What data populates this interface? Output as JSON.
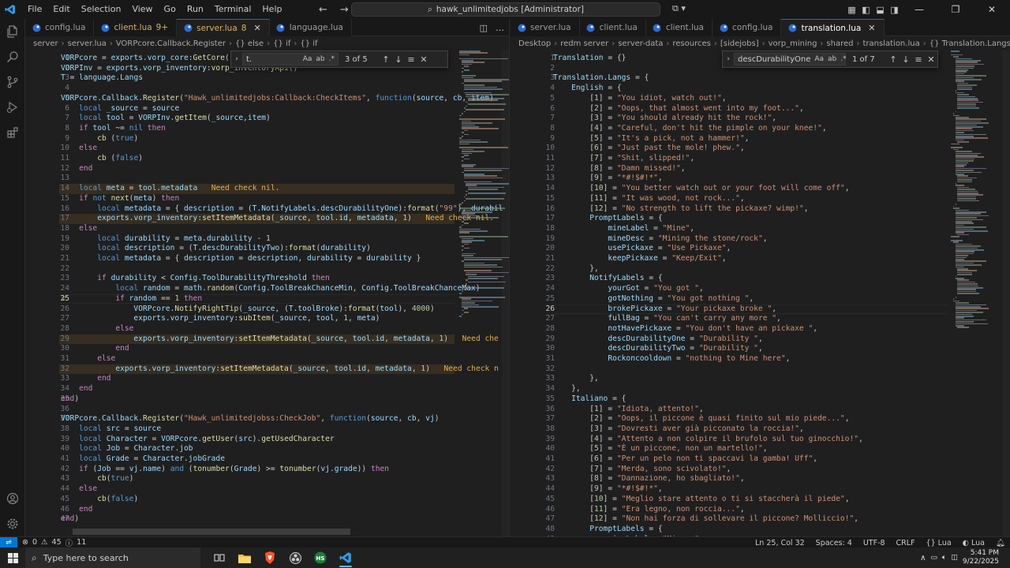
{
  "titlebar": {
    "menu": [
      "File",
      "Edit",
      "Selection",
      "View",
      "Go",
      "Run",
      "Terminal",
      "Help"
    ],
    "search_text": "hawk_unlimitedjobs [Administrator]"
  },
  "left": {
    "tabs": [
      {
        "label": "config.lua",
        "mod": "",
        "active": false
      },
      {
        "label": "client.lua",
        "mod": "9+",
        "active": false
      },
      {
        "label": "server.lua",
        "mod": "8",
        "active": true
      },
      {
        "label": "language.lua",
        "mod": "",
        "active": false
      }
    ],
    "breadcrumb": [
      "server",
      "server.lua",
      "VORPcore.Callback.Register",
      "{} else",
      "{} if",
      "{} if"
    ],
    "find": {
      "value": "t.",
      "count": "3 of 5"
    },
    "lines": [
      {
        "n": 1,
        "html": "<span class='var'>VORPcore</span> <span class='op'>=</span> <span class='var'>exports</span>.<span class='var'>vorp_core</span>:<span class='fn'>GetCore</span>()"
      },
      {
        "n": 2,
        "html": "<span class='var'>VORPInv</span> <span class='op'>=</span> <span class='var'>exports</span>.<span class='var'>vorp_inventory</span>:<span class='fn'>vorp_inventoryApi</span>()"
      },
      {
        "n": 3,
        "html": "<span class='var'>T</span> <span class='op'>=</span> <span class='var'>language</span>.<span class='var'>Langs</span>"
      },
      {
        "n": 4,
        "html": ""
      },
      {
        "n": 5,
        "html": "<span class='var'>VORPcore</span>.<span class='var'>Callback</span>.<span class='fn'>Register</span>(<span class='str'>\"Hawk_unlimitedjobs:Callback:CheckItems\"</span>, <span class='kb'>function</span>(<span class='var'>source</span>, <span class='var'>cb</span>, <span class='var'>item</span>)"
      },
      {
        "n": 6,
        "html": "    <span class='kb'>local</span> <span class='var'>_source</span> <span class='op'>=</span> <span class='var'>source</span>"
      },
      {
        "n": 7,
        "html": "    <span class='kb'>local</span> <span class='var'>tool</span> <span class='op'>=</span> <span class='var'>VORPInv</span>.<span class='fn'>getItem</span>(<span class='var'>_source</span>,<span class='var'>item</span>)"
      },
      {
        "n": 8,
        "html": "    <span class='kw'>if</span> <span class='var'>tool</span> <span class='op'>~=</span> <span class='kb'>nil</span> <span class='kw'>then</span>"
      },
      {
        "n": 9,
        "html": "        <span class='fn'>cb</span> (<span class='kb'>true</span>)"
      },
      {
        "n": 10,
        "html": "    <span class='kw'>else</span>"
      },
      {
        "n": 11,
        "html": "        <span class='fn'>cb</span> (<span class='kb'>false</span>)"
      },
      {
        "n": 12,
        "html": "    <span class='kw'>end</span>"
      },
      {
        "n": 13,
        "html": ""
      },
      {
        "n": 14,
        "html": "    <span class='kb'>local</span> <span class='var'>meta</span> <span class='op'>=</span> <span class='var'>tool</span>.<span class='var'>metadata</span>",
        "hint": "Need check nil.",
        "hl": true
      },
      {
        "n": 15,
        "html": "    <span class='kw'>if</span> <span class='kb'>not</span> <span class='fn'>next</span>(<span class='var'>meta</span>) <span class='kw'>then</span>"
      },
      {
        "n": 16,
        "html": "        <span class='kb'>local</span> <span class='var'>metadata</span> <span class='op'>=</span> { <span class='var'>description</span> <span class='op'>=</span> (<span class='var'>T</span>.<span class='var'>NotifyLabels</span>.<span class='var'>descDurabilityOne</span>):<span class='fn'>format</span>(<span class='str'>\"99\"</span>), <span class='var'>durabil</span>"
      },
      {
        "n": 17,
        "html": "        <span class='var'>exports</span>.<span class='var'>vorp_inventory</span>:<span class='fn'>setItemMetadata</span>(<span class='var'>_source</span>, <span class='var'>tool</span>.<span class='var'>id</span>, <span class='var'>metadata</span>, <span class='num'>1</span>)",
        "hint": "Need check nil.",
        "hl": true
      },
      {
        "n": 18,
        "html": "    <span class='kw'>else</span>"
      },
      {
        "n": 19,
        "html": "        <span class='kb'>local</span> <span class='var'>durability</span> <span class='op'>=</span> <span class='var'>meta</span>.<span class='var'>durability</span> <span class='op'>-</span> <span class='num'>1</span>"
      },
      {
        "n": 20,
        "html": "        <span class='kb'>local</span> <span class='var'>description</span> <span class='op'>=</span> (<span class='var'>T</span>.<span class='var'>descDurabilityTwo</span>):<span class='fn'>format</span>(<span class='var'>durability</span>)"
      },
      {
        "n": 21,
        "html": "        <span class='kb'>local</span> <span class='var'>metadata</span> <span class='op'>=</span> { <span class='var'>description</span> <span class='op'>=</span> <span class='var'>description</span>, <span class='var'>durability</span> <span class='op'>=</span> <span class='var'>durability</span> }"
      },
      {
        "n": 22,
        "html": ""
      },
      {
        "n": 23,
        "html": "        <span class='kw'>if</span> <span class='var'>durability</span> <span class='op'>&lt;</span> <span class='var'>Config</span>.<span class='var'>ToolDurabilityThreshold</span> <span class='kw'>then</span>"
      },
      {
        "n": 24,
        "html": "            <span class='kb'>local</span> <span class='var'>random</span> <span class='op'>=</span> <span class='var'>math</span>.<span class='fn'>random</span>(<span class='var'>Config</span>.<span class='var'>ToolBreakChanceMin</span>, <span class='var'>Config</span>.<span class='var'>ToolBreakChanceMax</span>)"
      },
      {
        "n": 25,
        "html": "            <span class='kw'>if</span> <span class='var'>random</span> <span class='op'>==</span> <span class='num'>1</span> <span class='kw'>then</span>",
        "cur": true
      },
      {
        "n": 26,
        "html": "                <span class='var'>VORPcore</span>.<span class='fn'>NotifyRightTip</span>(<span class='var'>_source</span>, (<span class='var'>T</span>.<span class='var'>toolBroke</span>):<span class='fn'>format</span>(<span class='var'>tool</span>), <span class='num'>4000</span>)"
      },
      {
        "n": 27,
        "html": "                <span class='var'>exports</span>.<span class='var'>vorp_inventory</span>:<span class='fn'>subItem</span>(<span class='var'>_source</span>, <span class='var'>tool</span>, <span class='num'>1</span>, <span class='var'>meta</span>)"
      },
      {
        "n": 28,
        "html": "            <span class='kw'>else</span>"
      },
      {
        "n": 29,
        "html": "                <span class='var'>exports</span>.<span class='var'>vorp_inventory</span>:<span class='fn'>setItemMetadata</span>(<span class='var'>_source</span>, <span class='var'>tool</span>.<span class='var'>id</span>, <span class='var'>metadata</span>, <span class='num'>1</span>)",
        "hint": "Need che",
        "hl": true
      },
      {
        "n": 30,
        "html": "            <span class='kw'>end</span>"
      },
      {
        "n": 31,
        "html": "        <span class='kw'>else</span>"
      },
      {
        "n": 32,
        "html": "            <span class='var'>exports</span>.<span class='var'>vorp_inventory</span>:<span class='fn'>setItemMetadata</span>(<span class='var'>_source</span>, <span class='var'>tool</span>.<span class='var'>id</span>, <span class='var'>metadata</span>, <span class='num'>1</span>)",
        "hint": "Need check n",
        "hl": true
      },
      {
        "n": 33,
        "html": "        <span class='kw'>end</span>"
      },
      {
        "n": 34,
        "html": "    <span class='kw'>end</span>"
      },
      {
        "n": 35,
        "html": "<span class='kw'>end</span>)"
      },
      {
        "n": 36,
        "html": ""
      },
      {
        "n": 37,
        "html": "<span class='var'>VORPcore</span>.<span class='var'>Callback</span>.<span class='fn'>Register</span>(<span class='str'>\"Hawk_unlimitedjobss:CheckJob\"</span>, <span class='kb'>function</span>(<span class='var'>source</span>, <span class='var'>cb</span>, <span class='var'>vj</span>)"
      },
      {
        "n": 38,
        "html": "    <span class='kb'>local</span> <span class='var'>src</span> <span class='op'>=</span> <span class='var'>source</span>"
      },
      {
        "n": 39,
        "html": "    <span class='kb'>local</span> <span class='var'>Character</span> <span class='op'>=</span> <span class='var'>VORPcore</span>.<span class='fn'>getUser</span>(<span class='var'>src</span>).<span class='fn'>getUsedCharacter</span>"
      },
      {
        "n": 40,
        "html": "    <span class='kb'>local</span> <span class='var'>Job</span> <span class='op'>=</span> <span class='var'>Character</span>.<span class='var'>job</span>"
      },
      {
        "n": 41,
        "html": "    <span class='kb'>local</span> <span class='var'>Grade</span> <span class='op'>=</span> <span class='var'>Character</span>.<span class='var'>jobGrade</span>"
      },
      {
        "n": 42,
        "html": "    <span class='kw'>if</span> (<span class='var'>Job</span> <span class='op'>==</span> <span class='var'>vj</span>.<span class='var'>name</span>) <span class='kb'>and</span> (<span class='fn'>tonumber</span>(<span class='var'>Grade</span>) <span class='op'>&gt;=</span> <span class='fn'>tonumber</span>(<span class='var'>vj</span>.<span class='var'>grade</span>)) <span class='kw'>then</span>"
      },
      {
        "n": 43,
        "html": "        <span class='fn'>cb</span>(<span class='kb'>true</span>)"
      },
      {
        "n": 44,
        "html": "    <span class='kw'>else</span>"
      },
      {
        "n": 45,
        "html": "        <span class='fn'>cb</span>(<span class='kb'>false</span>)"
      },
      {
        "n": 46,
        "html": "    <span class='kw'>end</span>"
      },
      {
        "n": 47,
        "html": "<span class='kw'>end</span>)"
      }
    ]
  },
  "right": {
    "tabs": [
      {
        "label": "server.lua",
        "mod": "",
        "active": false
      },
      {
        "label": "client.lua",
        "mod": "",
        "active": false
      },
      {
        "label": "client.lua",
        "mod": "",
        "active": false
      },
      {
        "label": "config.lua",
        "mod": "",
        "active": false
      },
      {
        "label": "translation.lua",
        "mod": "",
        "active": true
      }
    ],
    "breadcrumb": [
      "Desktop",
      "redm server",
      "server-data",
      "resources",
      "[sidejobs]",
      "vorp_mining",
      "shared",
      "translation.lua",
      "{} Translation.Langs",
      "{} English",
      "{} NotifyLabels"
    ],
    "find": {
      "value": "descDurabilityOne",
      "count": "1 of 7"
    },
    "lines": [
      {
        "n": 1,
        "html": "<span class='var'>Translation</span> <span class='op'>=</span> {}"
      },
      {
        "n": 2,
        "html": ""
      },
      {
        "n": 3,
        "html": "<span class='var'>Translation</span>.<span class='var'>Langs</span> <span class='op'>=</span> {"
      },
      {
        "n": 4,
        "html": "    <span class='var'>English</span> <span class='op'>=</span> {"
      },
      {
        "n": 5,
        "html": "        [<span class='num'>1</span>] <span class='op'>=</span> <span class='str'>\"You idiot, watch out!\"</span>,"
      },
      {
        "n": 6,
        "html": "        [<span class='num'>2</span>] <span class='op'>=</span> <span class='str'>\"Oops, that almost went into my foot...\"</span>,"
      },
      {
        "n": 7,
        "html": "        [<span class='num'>3</span>] <span class='op'>=</span> <span class='str'>\"You should already hit the rock!\"</span>,"
      },
      {
        "n": 8,
        "html": "        [<span class='num'>4</span>] <span class='op'>=</span> <span class='str'>\"Careful, don't hit the pimple on your knee!\"</span>,"
      },
      {
        "n": 9,
        "html": "        [<span class='num'>5</span>] <span class='op'>=</span> <span class='str'>\"It's a pick, not a hammer!\"</span>,"
      },
      {
        "n": 10,
        "html": "        [<span class='num'>6</span>] <span class='op'>=</span> <span class='str'>\"Just past the mole! phew.\"</span>,"
      },
      {
        "n": 11,
        "html": "        [<span class='num'>7</span>] <span class='op'>=</span> <span class='str'>\"Shit, slipped!\"</span>,"
      },
      {
        "n": 12,
        "html": "        [<span class='num'>8</span>] <span class='op'>=</span> <span class='str'>\"Damn missed!\"</span>,"
      },
      {
        "n": 13,
        "html": "        [<span class='num'>9</span>] <span class='op'>=</span> <span class='str'>\"*#!$#!*\"</span>,"
      },
      {
        "n": 14,
        "html": "        [<span class='num'>10</span>] <span class='op'>=</span> <span class='str'>\"You better watch out or your foot will come off\"</span>,"
      },
      {
        "n": 15,
        "html": "        [<span class='num'>11</span>] <span class='op'>=</span> <span class='str'>\"It was wood, not rock...\"</span>,"
      },
      {
        "n": 16,
        "html": "        [<span class='num'>12</span>] <span class='op'>=</span> <span class='str'>\"No strength to lift the pickaxe? wimp!\"</span>,"
      },
      {
        "n": 17,
        "html": "        <span class='var'>PromptLabels</span> <span class='op'>=</span> {"
      },
      {
        "n": 18,
        "html": "            <span class='var'>mineLabel</span> <span class='op'>=</span> <span class='str'>\"Mine\"</span>,"
      },
      {
        "n": 19,
        "html": "            <span class='var'>mineDesc</span> <span class='op'>=</span> <span class='str'>\"Mining the stone/rock\"</span>,"
      },
      {
        "n": 20,
        "html": "            <span class='var'>usePickaxe</span> <span class='op'>=</span> <span class='str'>\"Use Pickaxe\"</span>,"
      },
      {
        "n": 21,
        "html": "            <span class='var'>keepPickaxe</span> <span class='op'>=</span> <span class='str'>\"Keep/Exit\"</span>,"
      },
      {
        "n": 22,
        "html": "        },"
      },
      {
        "n": 23,
        "html": "        <span class='var'>NotifyLabels</span> <span class='op'>=</span> {"
      },
      {
        "n": 24,
        "html": "            <span class='var'>yourGot</span> <span class='op'>=</span> <span class='str'>\"You got \"</span>,"
      },
      {
        "n": 25,
        "html": "            <span class='var'>gotNothing</span> <span class='op'>=</span> <span class='str'>\"You got nothing \"</span>,"
      },
      {
        "n": 26,
        "html": "            <span class='var'>brokePickaxe</span> <span class='op'>=</span> <span class='str'>\"Your pickaxe broke \"</span>,",
        "cur": true
      },
      {
        "n": 27,
        "html": "            <span class='var'>fullBag</span> <span class='op'>=</span> <span class='str'>\"You can't carry any more \"</span>,"
      },
      {
        "n": 28,
        "html": "            <span class='var'>notHavePickaxe</span> <span class='op'>=</span> <span class='str'>\"You don't have an pickaxe \"</span>,"
      },
      {
        "n": 29,
        "html": "            <span class='var'>descDurabilityOne</span> <span class='op'>=</span> <span class='str'>\"Durability \"</span>,"
      },
      {
        "n": 30,
        "html": "            <span class='var'>descDurabilityTwo</span> <span class='op'>=</span> <span class='str'>\"Durability \"</span>,"
      },
      {
        "n": 31,
        "html": "            <span class='var'>Rockoncooldown</span> <span class='op'>=</span> <span class='str'>\"nothing to Mine here\"</span>,"
      },
      {
        "n": 32,
        "html": ""
      },
      {
        "n": 33,
        "html": "        },"
      },
      {
        "n": 34,
        "html": "    },"
      },
      {
        "n": 35,
        "html": "    <span class='var'>Italiano</span> <span class='op'>=</span> {"
      },
      {
        "n": 36,
        "html": "        [<span class='num'>1</span>] <span class='op'>=</span> <span class='str'>\"Idiota, attento!\"</span>,"
      },
      {
        "n": 37,
        "html": "        [<span class='num'>2</span>] <span class='op'>=</span> <span class='str'>\"Oops, il piccone è quasi finito sul mio piede...\"</span>,"
      },
      {
        "n": 38,
        "html": "        [<span class='num'>3</span>] <span class='op'>=</span> <span class='str'>\"Dovresti aver già picconato la roccia!\"</span>,"
      },
      {
        "n": 39,
        "html": "        [<span class='num'>4</span>] <span class='op'>=</span> <span class='str'>\"Attento a non colpire il brufolo sul tuo ginocchio!\"</span>,"
      },
      {
        "n": 40,
        "html": "        [<span class='num'>5</span>] <span class='op'>=</span> <span class='str'>\"È un piccone, non un martello!\"</span>,"
      },
      {
        "n": 41,
        "html": "        [<span class='num'>6</span>] <span class='op'>=</span> <span class='str'>\"Per un pelo non ti spaccavi la gamba! Uff\"</span>,"
      },
      {
        "n": 42,
        "html": "        [<span class='num'>7</span>] <span class='op'>=</span> <span class='str'>\"Merda, sono scivolato!\"</span>,"
      },
      {
        "n": 43,
        "html": "        [<span class='num'>8</span>] <span class='op'>=</span> <span class='str'>\"Dannazione, ho sbagliato!\"</span>,"
      },
      {
        "n": 44,
        "html": "        [<span class='num'>9</span>] <span class='op'>=</span> <span class='str'>\"*#!$#!*\"</span>,"
      },
      {
        "n": 45,
        "html": "        [<span class='num'>10</span>] <span class='op'>=</span> <span class='str'>\"Meglio stare attento o ti si staccherà il piede\"</span>,"
      },
      {
        "n": 46,
        "html": "        [<span class='num'>11</span>] <span class='op'>=</span> <span class='str'>\"Era legno, non roccia...\"</span>,"
      },
      {
        "n": 47,
        "html": "        [<span class='num'>12</span>] <span class='op'>=</span> <span class='str'>\"Non hai forza di sollevare il piccone? Molliccio!\"</span>,"
      },
      {
        "n": 48,
        "html": "        <span class='var'>PromptLabels</span> <span class='op'>=</span> {"
      },
      {
        "n": 49,
        "html": "            <span class='var'>mineLabel</span> <span class='op'>=</span> <span class='str'>\"Minare\"</span>,"
      }
    ]
  },
  "status": {
    "errors": "0",
    "warnings": "45",
    "info": "11",
    "position": "Ln 25, Col 32",
    "spaces": "Spaces: 4",
    "encoding": "UTF-8",
    "eol": "CRLF",
    "language": "Lua",
    "lua_server": "Lua"
  },
  "taskbar": {
    "search_placeholder": "Type here to search",
    "time": "5:41 PM",
    "date": "9/22/2025"
  },
  "colors": {
    "accent": "#0078d4",
    "warning_hint": "#e0b050"
  }
}
